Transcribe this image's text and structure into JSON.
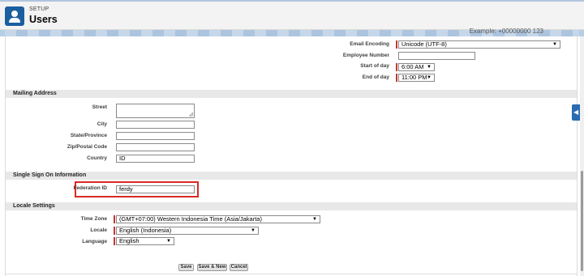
{
  "header": {
    "eyebrow": "SETUP",
    "title": "Users",
    "icon": "user-icon"
  },
  "band": {
    "partial_text": "Example: +00000000 123"
  },
  "fields_top": {
    "email_encoding": {
      "label": "Email Encoding",
      "value": "Unicode (UTF-8)"
    },
    "employee_number": {
      "label": "Employee Number",
      "value": ""
    },
    "start_of_day": {
      "label": "Start of day",
      "value": "6:00 AM"
    },
    "end_of_day": {
      "label": "End of day",
      "value": "11:00 PM"
    }
  },
  "mailing": {
    "title": "Mailing Address",
    "street": {
      "label": "Street",
      "value": ""
    },
    "city": {
      "label": "City",
      "value": ""
    },
    "state": {
      "label": "State/Province",
      "value": ""
    },
    "zip": {
      "label": "Zip/Postal Code",
      "value": ""
    },
    "country": {
      "label": "Country",
      "value": "ID"
    }
  },
  "sso": {
    "title": "Single Sign On Information",
    "federation_id": {
      "label": "Federation ID",
      "value": "ferdy"
    }
  },
  "locale_settings": {
    "title": "Locale Settings",
    "time_zone": {
      "label": "Time Zone",
      "value": "(GMT+07:00) Western Indonesia Time (Asia/Jakarta)"
    },
    "locale": {
      "label": "Locale",
      "value": "English (Indonesia)"
    },
    "language": {
      "label": "Language",
      "value": "English"
    }
  },
  "buttons": {
    "save": "Save",
    "save_new": "Save & New",
    "cancel": "Cancel"
  },
  "colors": {
    "accent": "#1b5f9e",
    "required": "#c23934",
    "highlight": "#d92a24"
  }
}
